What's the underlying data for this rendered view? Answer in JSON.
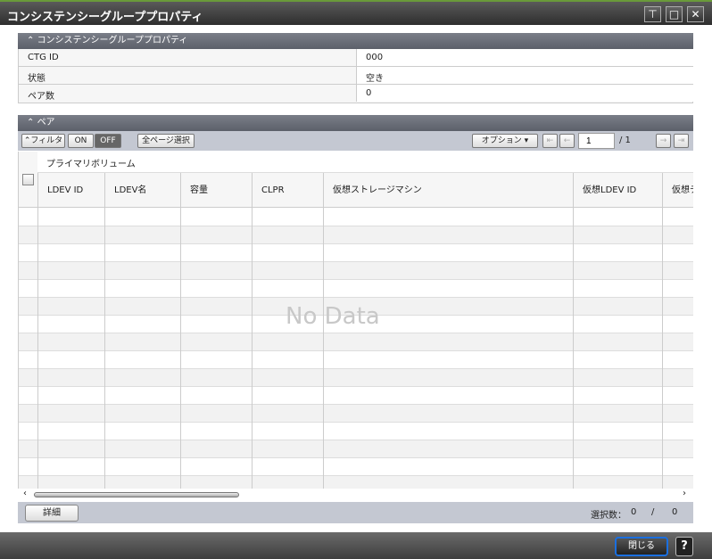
{
  "window": {
    "title": "コンシステンシーグループプロパティ",
    "buttons": [
      "restore-icon",
      "maximize-icon",
      "close-icon"
    ]
  },
  "properties": {
    "header": "コンシステンシーグループプロパティ",
    "rows": [
      {
        "label": "CTG ID",
        "value": "000"
      },
      {
        "label": "状態",
        "value": "空き"
      },
      {
        "label": "ペア数",
        "value": "0"
      }
    ]
  },
  "pairs": {
    "header": "ペア",
    "toolbar": {
      "filter": "フィルタ",
      "on": "ON",
      "off": "OFF",
      "select_all": "全ページ選択",
      "options": "オプション",
      "page": "1",
      "total_pages": "/ 1"
    },
    "group_header": "プライマリボリューム",
    "columns": [
      "LDEV ID",
      "LDEV名",
      "容量",
      "CLPR",
      "仮想ストレージマシン",
      "仮想LDEV ID",
      "仮想デ"
    ],
    "no_data": "No Data",
    "detail_button": "詳細",
    "selection": {
      "label": "選択数：",
      "selected": "0",
      "sep": "/",
      "total": "0"
    }
  },
  "dialog": {
    "close": "閉じる",
    "help": "?"
  }
}
